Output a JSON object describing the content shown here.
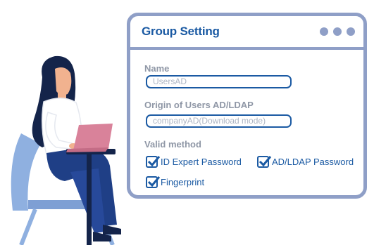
{
  "window": {
    "title": "Group Setting",
    "controls": [
      "dot-1",
      "dot-2",
      "dot-3"
    ]
  },
  "form": {
    "name": {
      "label": "Name",
      "value": "UsersAD"
    },
    "origin": {
      "label": "Origin of Users AD/LDAP",
      "value": "companyAD(Download mode)"
    },
    "valid_method": {
      "label": "Valid method",
      "options": [
        {
          "label": "ID Expert Password",
          "checked": true
        },
        {
          "label": "AD/LDAP Password",
          "checked": true
        },
        {
          "label": "Fingerprint",
          "checked": true
        }
      ]
    }
  },
  "colors": {
    "accent": "#1b5aa3",
    "frame": "#8f9fc7",
    "muted_label": "#8f97a6",
    "laptop": "#d9829a"
  },
  "illustration": {
    "icon": "woman-with-laptop-illustration"
  }
}
